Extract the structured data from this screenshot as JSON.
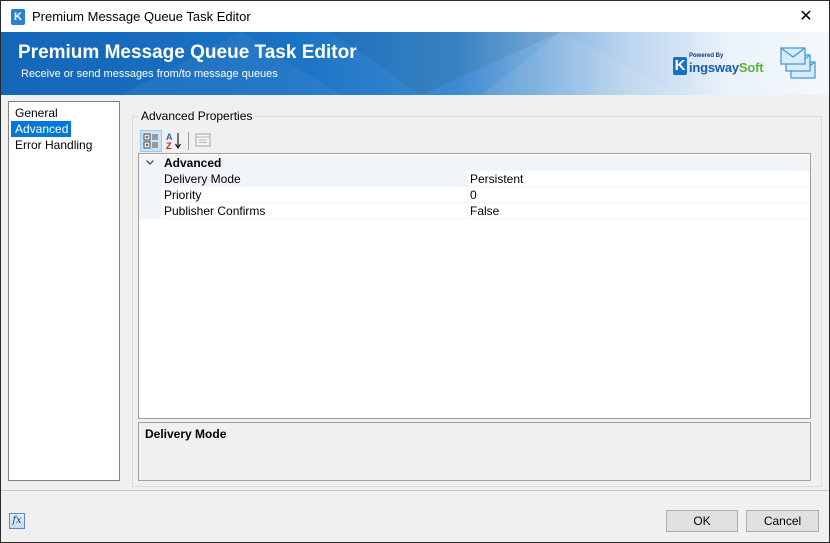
{
  "window": {
    "title": "Premium Message Queue Task Editor",
    "app_icon": "kingswaysoft-k-icon",
    "close_label": "✕"
  },
  "banner": {
    "title": "Premium Message Queue Task Editor",
    "subtitle": "Receive or send messages from/to message queues",
    "logo_powered": "Powered By",
    "logo_k": "K",
    "logo_brand_a": "ingsway",
    "logo_brand_b": "Soft",
    "icon": "mail-stack-icon"
  },
  "nav": {
    "items": [
      {
        "label": "General",
        "selected": false
      },
      {
        "label": "Advanced",
        "selected": true
      },
      {
        "label": "Error Handling",
        "selected": false
      }
    ]
  },
  "properties": {
    "group_label": "Advanced Properties",
    "toolbar": {
      "categorized": "categorized-view-icon",
      "alphabetical": "sort-alphabetical-icon",
      "property_pages": "property-pages-icon"
    },
    "category": "Advanced",
    "rows": [
      {
        "name": "Delivery Mode",
        "value": "Persistent"
      },
      {
        "name": "Priority",
        "value": "0"
      },
      {
        "name": "Publisher Confirms",
        "value": "False"
      }
    ],
    "description_title": "Delivery Mode"
  },
  "footer": {
    "fx_label": "fx",
    "ok_label": "OK",
    "cancel_label": "Cancel"
  }
}
